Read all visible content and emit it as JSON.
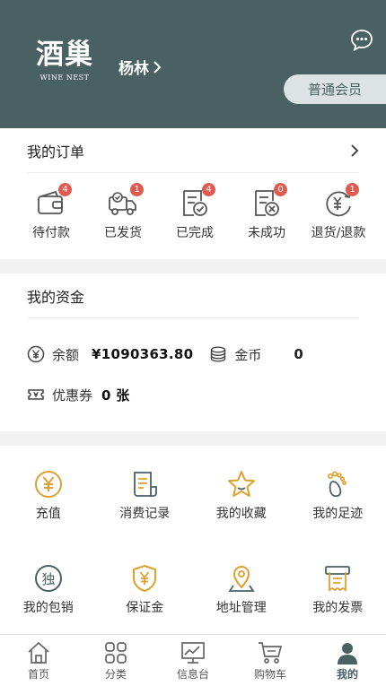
{
  "header": {
    "logo_cn": "酒巢",
    "logo_en": "WINE NEST",
    "username": "杨林",
    "member_level": "普通会员",
    "brand_color": "#4a6164"
  },
  "orders": {
    "title": "我的订单",
    "items": [
      {
        "label": "待付款",
        "badge": "4",
        "icon": "wallet-icon"
      },
      {
        "label": "已发货",
        "badge": "1",
        "icon": "truck-icon"
      },
      {
        "label": "已完成",
        "badge": "4",
        "icon": "completed-doc-icon"
      },
      {
        "label": "未成功",
        "badge": "0",
        "icon": "failed-doc-icon"
      },
      {
        "label": "退货/退款",
        "badge": "1",
        "icon": "refund-icon"
      }
    ]
  },
  "funds": {
    "title": "我的资金",
    "balance_label": "余额",
    "balance_value": "¥1090363.80",
    "coins_label": "金币",
    "coins_value": "0",
    "coupon_label": "优惠券",
    "coupon_value": "0 张"
  },
  "tools": [
    {
      "label": "充值",
      "icon": "recharge-icon"
    },
    {
      "label": "消费记录",
      "icon": "receipt-icon"
    },
    {
      "label": "我的收藏",
      "icon": "star-icon"
    },
    {
      "label": "我的足迹",
      "icon": "footprint-icon"
    },
    {
      "label": "我的包销",
      "icon": "exclusive-icon"
    },
    {
      "label": "保证金",
      "icon": "shield-yen-icon"
    },
    {
      "label": "地址管理",
      "icon": "location-icon"
    },
    {
      "label": "我的发票",
      "icon": "invoice-icon"
    }
  ],
  "tabbar": [
    {
      "label": "首页",
      "icon": "home-icon"
    },
    {
      "label": "分类",
      "icon": "category-icon"
    },
    {
      "label": "信息台",
      "icon": "chart-board-icon"
    },
    {
      "label": "购物车",
      "icon": "cart-icon"
    },
    {
      "label": "我的",
      "icon": "user-icon",
      "active": true
    }
  ],
  "colors": {
    "accent": "#e0a030",
    "badge": "#e05a4f",
    "icon_gray": "#555555"
  }
}
